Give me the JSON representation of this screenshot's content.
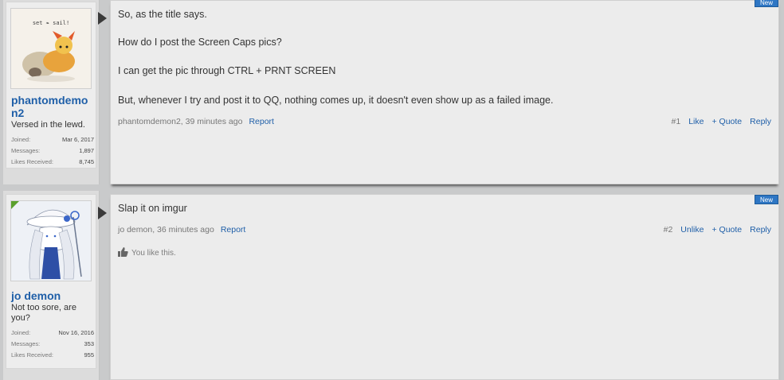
{
  "posts": [
    {
      "username": "phantomdemon2",
      "user_title": "Versed in the lewd.",
      "avatar_caption": "set ❧ sail!",
      "stats": [
        {
          "label": "Joined:",
          "value": "Mar 6, 2017"
        },
        {
          "label": "Messages:",
          "value": "1,897"
        },
        {
          "label": "Likes Received:",
          "value": "8,745"
        }
      ],
      "badge": "New",
      "lines": [
        "So, as the title says.",
        "How do I post the Screen Caps pics?",
        "I can get the pic through CTRL + PRNT SCREEN",
        "But, whenever I try and post it to QQ, nothing comes up, it doesn't even show up as a failed image."
      ],
      "meta": {
        "author_time": "phantomdemon2, 39 minutes ago",
        "report": "Report",
        "number": "#1",
        "like": "Like",
        "quote": "+ Quote",
        "reply": "Reply"
      }
    },
    {
      "username": "jo demon",
      "user_title": "Not too sore, are you?",
      "stats": [
        {
          "label": "Joined:",
          "value": "Nov 16, 2016"
        },
        {
          "label": "Messages:",
          "value": "353"
        },
        {
          "label": "Likes Received:",
          "value": "955"
        }
      ],
      "badge": "New",
      "lines": [
        "Slap it on imgur"
      ],
      "meta": {
        "author_time": "jo demon, 36 minutes ago",
        "report": "Report",
        "number": "#2",
        "like": "Unlike",
        "quote": "+ Quote",
        "reply": "Reply"
      },
      "likes_summary": "You like this."
    }
  ],
  "colors": {
    "link": "#1f5fa8",
    "badge": "#2e76c4",
    "avatar_accent_green": "#5aa02c"
  },
  "icons": [
    "thumbs-up-icon",
    "post-pointer-arrow"
  ]
}
